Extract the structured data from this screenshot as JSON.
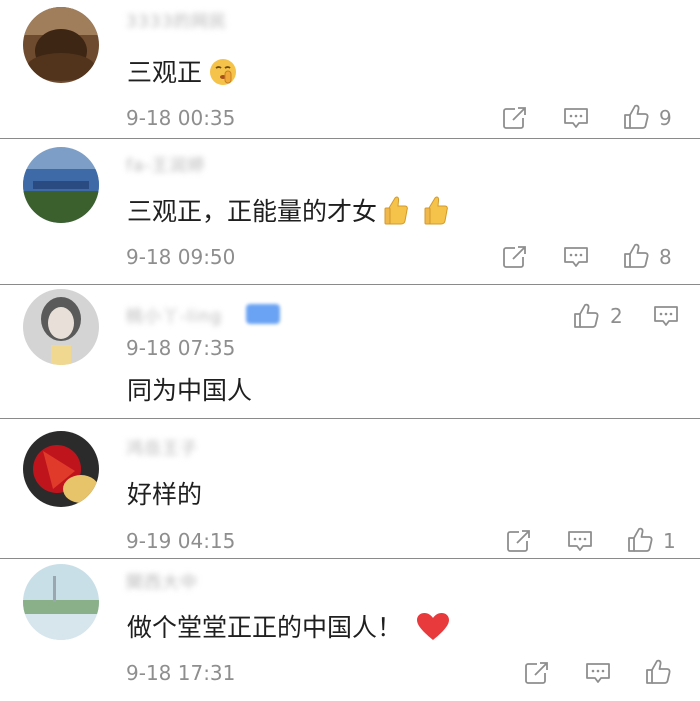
{
  "comments": [
    {
      "username": "3333的网民",
      "text": "三观正",
      "time": "9-18 00:35",
      "likes": "9"
    },
    {
      "username": "fa-王润婷",
      "text": "三观正，正能量的才女",
      "time": "9-18 09:50",
      "likes": "8"
    },
    {
      "username": "桃小丫-ling",
      "text": "同为中国人",
      "time": "9-18 07:35",
      "likes": "2"
    },
    {
      "username": "鸿岳王子",
      "text": "好样的",
      "time": "9-19 04:15",
      "likes": "1"
    },
    {
      "username": "関西大中",
      "text": "做个堂堂正正的中国人！",
      "time": "9-18 17:31",
      "likes": ""
    }
  ],
  "icons": {
    "share": "share-icon",
    "comment": "comment-icon",
    "like": "thumbs-up-icon",
    "emoji_shh": "shushing-face-emoji",
    "emoji_thumb": "thumbs-up-emoji",
    "emoji_heart": "red-heart-emoji"
  },
  "colors": {
    "meta": "#8e8e8e",
    "text": "#1f1f1f",
    "divider": "#8a8a8a",
    "heart": "#e8393c",
    "emoji_yellow": "#f5c24a"
  }
}
